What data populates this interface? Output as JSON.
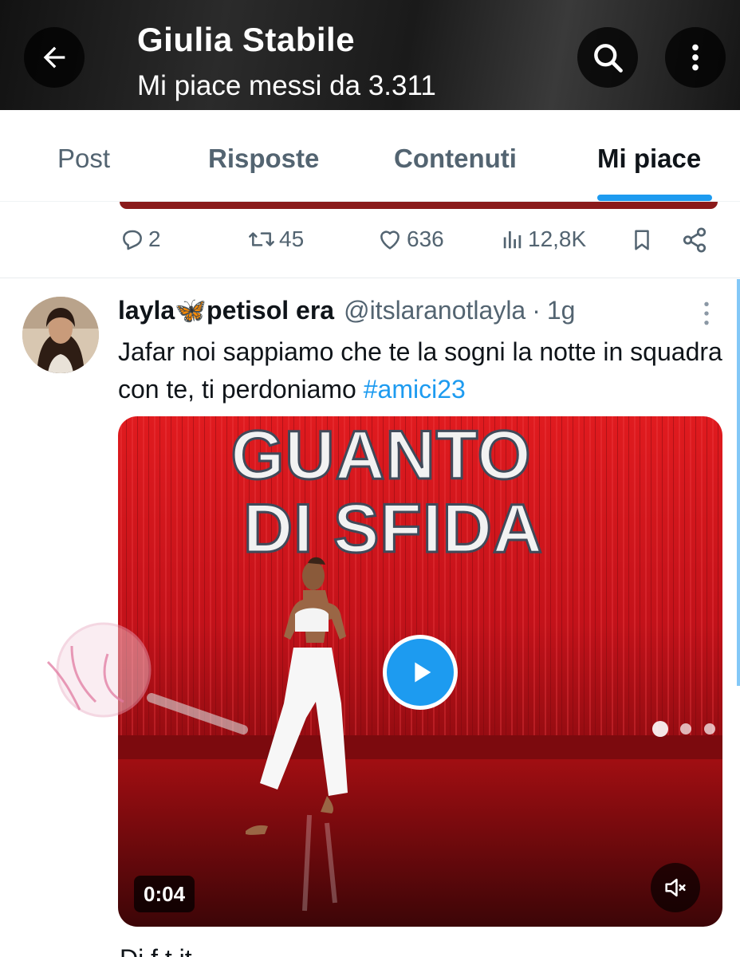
{
  "header": {
    "title": "Giulia Stabile",
    "subtitle": "Mi piace messi da 3.311",
    "back_icon": "arrow-left-icon",
    "search_icon": "search-icon",
    "more_icon": "more-vertical-icon"
  },
  "tabs": [
    {
      "label": "Post",
      "active": false
    },
    {
      "label": "Risposte",
      "active": false
    },
    {
      "label": "Contenuti",
      "active": false
    },
    {
      "label": "Mi piace",
      "active": true
    }
  ],
  "previous_tweet": {
    "actions": {
      "replies": "2",
      "reposts": "45",
      "likes": "636",
      "views": "12,8K"
    }
  },
  "tweet": {
    "name": "layla🦋petisol era",
    "handle": "@itslaranotlayla",
    "separator": "·",
    "time": "1g",
    "text_before": "Jafar noi sappiamo che te la sogni la notte in squadra con te, ti perdoniamo ",
    "hashtag": "#amici23",
    "video": {
      "overlay_line1": "GUANTO",
      "overlay_line2": "DI SFIDA",
      "duration": "0:04"
    }
  },
  "next_tweet_fragment": "Di  f     t   it",
  "colors": {
    "accent": "#1d9bf0",
    "text": "#0f1419",
    "muted": "#536471",
    "stage_red": "#c8141a"
  }
}
